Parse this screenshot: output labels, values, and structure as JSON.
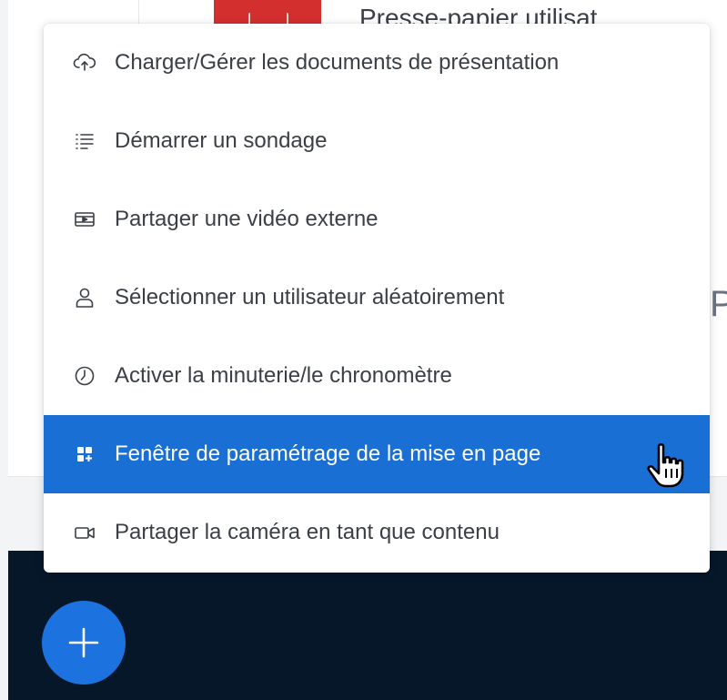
{
  "background": {
    "top_text": "Presse-papier utilisat",
    "right_letter": "P"
  },
  "menu": {
    "items": [
      {
        "label": "Charger/Gérer les documents de présentation",
        "icon": "cloud-upload-icon",
        "active": false
      },
      {
        "label": "Démarrer un sondage",
        "icon": "list-icon",
        "active": false
      },
      {
        "label": "Partager une vidéo externe",
        "icon": "video-icon",
        "active": false
      },
      {
        "label": "Sélectionner un utilisateur aléatoirement",
        "icon": "user-icon",
        "active": false
      },
      {
        "label": "Activer la minuterie/le chronomètre",
        "icon": "clock-icon",
        "active": false
      },
      {
        "label": "Fenêtre de paramétrage de la mise en page",
        "icon": "layout-icon",
        "active": true
      },
      {
        "label": "Partager la caméra en tant que contenu",
        "icon": "camera-icon",
        "active": false
      }
    ]
  },
  "actions": {
    "plus_button_icon": "plus-icon"
  },
  "colors": {
    "accent": "#1a6fd4",
    "plus_button": "#1c73df",
    "dark_bar": "#06172a",
    "red_block": "#d32f2f"
  }
}
